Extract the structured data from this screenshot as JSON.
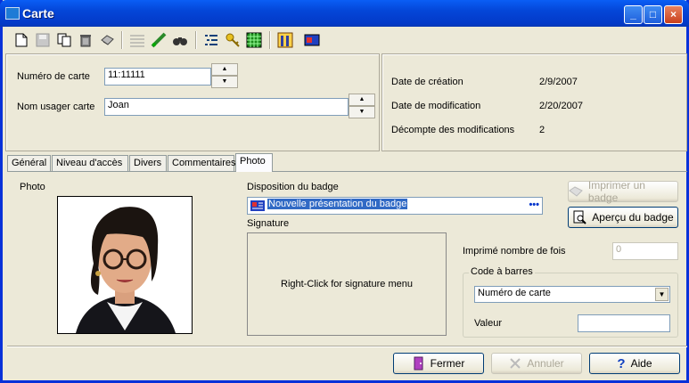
{
  "window": {
    "title": "Carte"
  },
  "card": {
    "number_label": "Numéro de carte",
    "number_value": "11:11111",
    "user_label": "Nom usager carte",
    "user_value": "Joan"
  },
  "dates": {
    "created_label": "Date de création",
    "created_value": "2/9/2007",
    "modified_label": "Date de modification",
    "modified_value": "2/20/2007",
    "count_label": "Décompte des modifications",
    "count_value": "2"
  },
  "tabs": [
    "Général",
    "Niveau d'accès",
    "Divers",
    "Commentaires",
    "Photo"
  ],
  "photo_tab": {
    "photo_label": "Photo",
    "layout_label": "Disposition du badge",
    "layout_value": "Nouvelle présentation du badge",
    "layout_more": "•••",
    "signature_label": "Signature",
    "signature_hint": "Right-Click for signature menu",
    "print_label": "Imprimer un badge",
    "preview_label": "Aperçu du badge",
    "printed_label": "Imprimé nombre de fois",
    "printed_value": "0",
    "barcode_group": "Code à barres",
    "barcode_select": "Numéro de carte",
    "value_label": "Valeur",
    "value_value": ""
  },
  "footer": {
    "close_label": "Fermer",
    "cancel_label": "Annuler",
    "help_label": "Aide"
  },
  "icons": [
    "new-icon",
    "save-icon",
    "copy-icon",
    "delete-icon",
    "print-icon",
    "list-icon",
    "connect-icon",
    "find-icon",
    "tree-icon",
    "key-icon",
    "grid-icon",
    "report-icon",
    "badge-icon"
  ]
}
